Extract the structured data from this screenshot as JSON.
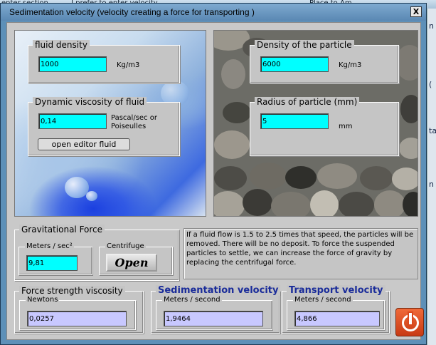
{
  "background": {
    "top_left_text": "enter section",
    "top_mid_text": "I prefer to enter velocity",
    "top_right_text": "Place to Am",
    "right_edge_chars": [
      "n",
      "(",
      "ta",
      "n"
    ]
  },
  "window": {
    "title": "Sedimentation velocity (velocity creating a force for transporting )",
    "close_label": "X"
  },
  "fluid_density": {
    "legend": "fluid density",
    "value": "1000",
    "unit": "Kg/m3"
  },
  "viscosity": {
    "legend": "Dynamic viscosity of fluid",
    "value": "0,14",
    "unit_line1": "Pascal/sec or",
    "unit_line2": "Poiseulles",
    "editor_button": "open editor fluid"
  },
  "particle_density": {
    "legend": "Density of the particle",
    "value": "6000",
    "unit": "Kg/m3"
  },
  "radius": {
    "legend": "Radius of particle (mm)",
    "value": "5",
    "unit": "mm"
  },
  "gravitational": {
    "legend": "Gravitational Force",
    "sub_legend": "Meters / sec²",
    "value": "9,81",
    "centrifuge_legend": "Centrifuge",
    "open_button": "Open"
  },
  "info_text": "If a fluid flow is 1.5 to 2.5 times that speed, the particles will be removed. There will be no deposit. To force the suspended particles to settle, we can increase the force of gravity by replacing the centrifugal force.",
  "viscosity_force": {
    "legend": "Force strength viscosity",
    "sub_legend": "Newtons",
    "value": "0,0257"
  },
  "sedimentation": {
    "legend": "Sedimentation velocity",
    "sub_legend": "Meters / second",
    "value": "1,9464"
  },
  "transport": {
    "legend": "Transport velocity",
    "sub_legend": "Meters / second",
    "value": "4,866"
  },
  "colors": {
    "input_cyan": "#00ffff",
    "output_lavender": "#c8c8ff",
    "heading_blue": "#1a2c9a",
    "quit_orange": "#e0552a"
  },
  "icons": {
    "quit": "power-icon"
  }
}
